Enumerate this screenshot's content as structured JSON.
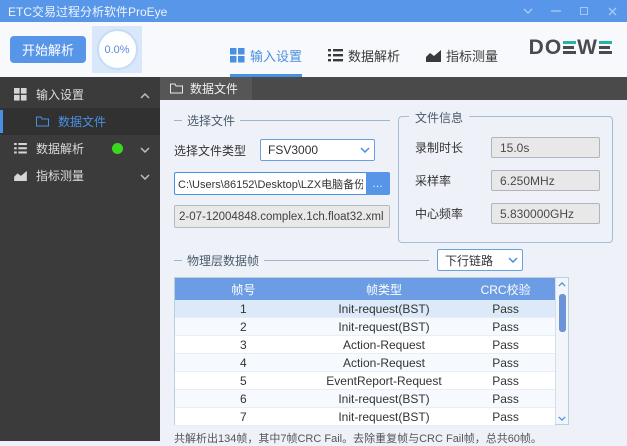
{
  "window": {
    "title": "ETC交易过程分析软件ProEye"
  },
  "toolbar": {
    "start_button_label": "开始解析",
    "progress_value": "0.0%",
    "tabs": [
      {
        "label": "输入设置",
        "active": true
      },
      {
        "label": "数据解析",
        "active": false
      },
      {
        "label": "指标测量",
        "active": false
      }
    ],
    "logo_text_left": "DO",
    "logo_text_w": "W"
  },
  "sidebar": {
    "items": [
      {
        "label": "输入设置",
        "expanded": true
      },
      {
        "label": "数据文件",
        "active": true
      },
      {
        "label": "数据解析",
        "has_green_dot": true
      },
      {
        "label": "指标测量"
      }
    ]
  },
  "content": {
    "active_tab": "数据文件",
    "select_file_group": {
      "legend": "选择文件",
      "file_type_label": "选择文件类型",
      "file_type_value": "FSV3000",
      "file_path": "C:\\Users\\86152\\Desktop\\LZX电脑备份",
      "browse_label": "…",
      "file_name": "2-07-12004848.complex.1ch.float32.xml"
    },
    "file_info_group": {
      "legend": "文件信息",
      "fields": [
        {
          "label": "录制时长",
          "value": "15.0s"
        },
        {
          "label": "采样率",
          "value": "6.250MHz"
        },
        {
          "label": "中心频率",
          "value": "5.830000GHz"
        }
      ]
    },
    "frames_group": {
      "legend": "物理层数据帧",
      "link_selector_value": "下行链路",
      "table": {
        "headers": [
          "帧号",
          "帧类型",
          "CRC校验"
        ],
        "rows": [
          [
            "1",
            "Init-request(BST)",
            "Pass"
          ],
          [
            "2",
            "Init-request(BST)",
            "Pass"
          ],
          [
            "3",
            "Action-Request",
            "Pass"
          ],
          [
            "4",
            "Action-Request",
            "Pass"
          ],
          [
            "5",
            "EventReport-Request",
            "Pass"
          ],
          [
            "6",
            "Init-request(BST)",
            "Pass"
          ],
          [
            "7",
            "Init-request(BST)",
            "Pass"
          ]
        ]
      },
      "summary": "共解析出134帧，其中7帧CRC Fail。去除重复帧与CRC Fail帧，总共60帧。"
    }
  },
  "icons": {
    "window": [
      "chevron-down-icon",
      "minimize-icon",
      "maximize-icon",
      "close-icon"
    ],
    "tabs": [
      "grid-icon",
      "list-icon",
      "area-chart-icon"
    ],
    "sidebar": [
      "grid-icon",
      "folder-icon",
      "list-icon",
      "area-chart-icon",
      "status-dot"
    ],
    "scrollbar": [
      "scroll-up-icon",
      "scroll-down-icon"
    ]
  },
  "colors": {
    "titlebar": "#5796e8",
    "accent": "#4a90e2",
    "sidebar_bg": "#3b3b3b",
    "table_header": "#6c9ce3",
    "status_green": "#3bd61e",
    "logo_teal": "#29b3a2"
  }
}
